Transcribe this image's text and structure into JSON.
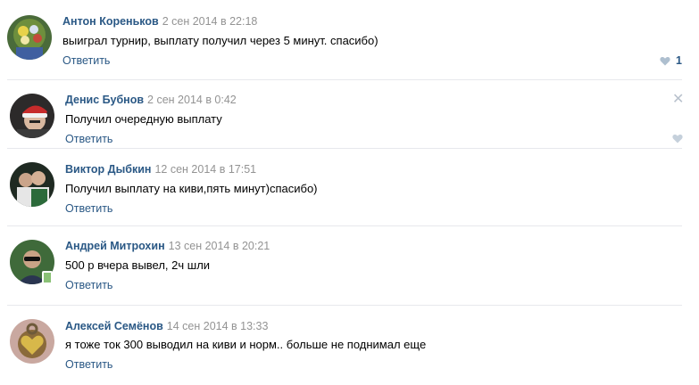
{
  "comments": [
    {
      "author": "Антон Кореньков",
      "date": "2 сен 2014 в 22:18",
      "text": "выиграл турнир, выплату получил через 5 минут. спасибо)",
      "reply_label": "Ответить",
      "likes": "1",
      "avatar_icon": "flowers-avatar"
    },
    {
      "author": "Денис Бубнов",
      "date": "2 сен 2014 в 0:42",
      "text": "Получил очередную выплату",
      "reply_label": "Ответить",
      "likes": "",
      "avatar_icon": "santa-hat-avatar"
    },
    {
      "author": "Виктор Дыбкин",
      "date": "12 сен 2014 в 17:51",
      "text": "Получил выплату на киви,пять минут)спасибо)",
      "reply_label": "Ответить",
      "likes": "",
      "avatar_icon": "couple-avatar"
    },
    {
      "author": "Андрей Митрохин",
      "date": "13 сен 2014 в 20:21",
      "text": "500 р вчера вывел, 2ч шли",
      "reply_label": "Ответить",
      "likes": "",
      "avatar_icon": "man-sunglasses-avatar"
    },
    {
      "author": "Алексей Семёнов",
      "date": "14 сен 2014 в 13:33",
      "text": "я тоже ток 300 выводил на киви и норм.. больше не поднимал еще",
      "reply_label": "Ответить",
      "likes": "",
      "avatar_icon": "heart-lock-avatar"
    }
  ],
  "colors": {
    "author_link": "#2a5885",
    "date": "#939393",
    "divider": "#e7e8ec",
    "like_heart": "#aebfcf"
  },
  "icons": {
    "close": "close-icon",
    "like": "heart-icon",
    "online": "mobile-online-icon"
  }
}
